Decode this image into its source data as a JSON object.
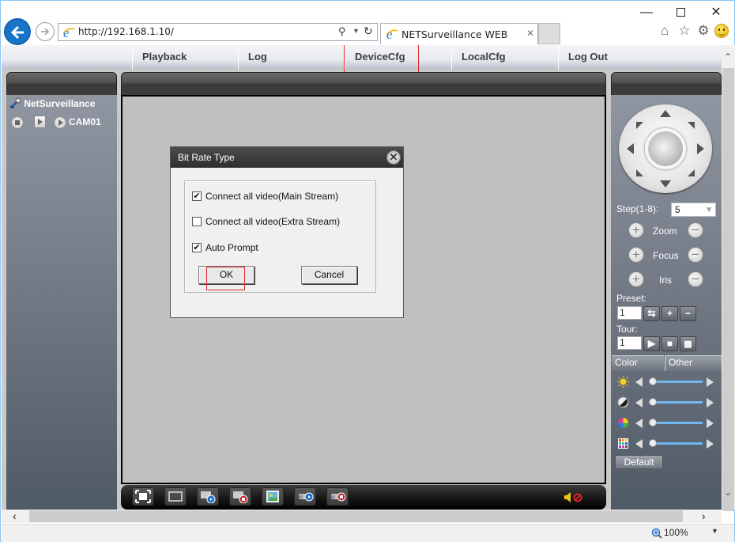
{
  "browser": {
    "url": "http://192.168.1.10/",
    "tab_title": "NETSurveillance WEB",
    "zoom_level": "100%",
    "icons": {
      "back": "back-arrow-icon",
      "forward": "forward-arrow-icon",
      "search": "search-icon",
      "refresh": "refresh-icon",
      "home": "home-icon",
      "favorites": "star-icon",
      "settings": "gear-icon",
      "feedback": "smiley-icon"
    }
  },
  "menu": {
    "items": [
      {
        "label": "Playback"
      },
      {
        "label": "Log"
      },
      {
        "label": "DeviceCfg"
      },
      {
        "label": "LocalCfg"
      },
      {
        "label": "Log Out"
      }
    ],
    "highlighted": "DeviceCfg"
  },
  "device_tree": {
    "root": "NetSurveillance",
    "channels": [
      {
        "label": "CAM01"
      }
    ]
  },
  "dialog": {
    "title": "Bit Rate Type",
    "options": [
      {
        "label": "Connect all video(Main Stream)",
        "checked": true
      },
      {
        "label": "Connect all video(Extra Stream)",
        "checked": false
      },
      {
        "label": "Auto Prompt",
        "checked": true
      }
    ],
    "ok_label": "OK",
    "cancel_label": "Cancel",
    "highlighted": "OK"
  },
  "ptz": {
    "step_label": "Step(1-8):",
    "step_value": "5",
    "zoom_label": "Zoom",
    "focus_label": "Focus",
    "iris_label": "Iris",
    "preset_label": "Preset:",
    "preset_value": "1",
    "tour_label": "Tour:",
    "tour_value": "1"
  },
  "color_panel": {
    "tabs": [
      {
        "label": "Color"
      },
      {
        "label": "Other"
      }
    ],
    "sliders": [
      {
        "name": "brightness",
        "value": 0
      },
      {
        "name": "contrast",
        "value": 0
      },
      {
        "name": "saturation",
        "value": 0
      },
      {
        "name": "hue",
        "value": 0
      }
    ],
    "default_label": "Default"
  },
  "video_toolbar": {
    "buttons": [
      "fullscreen-icon",
      "single-view-icon",
      "start-all-video-icon",
      "stop-all-video-icon",
      "snapshot-icon",
      "start-record-icon",
      "stop-record-icon"
    ],
    "audio": "speaker-muted-icon"
  }
}
